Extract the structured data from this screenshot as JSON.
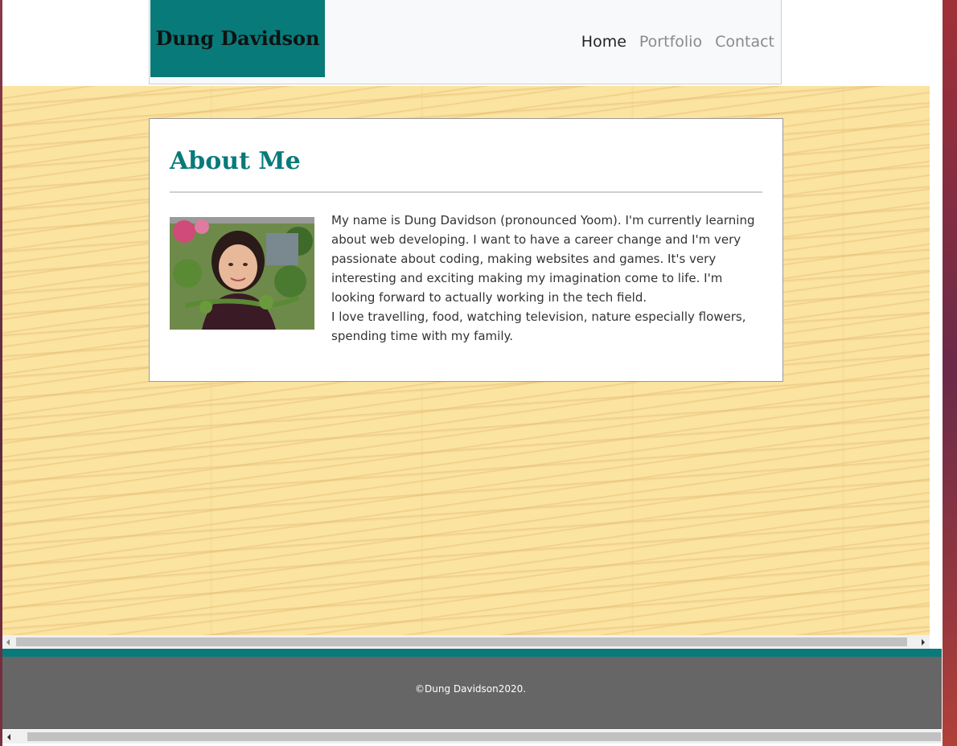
{
  "header": {
    "brand": "Dung Davidson",
    "nav": [
      {
        "label": "Home",
        "active": true
      },
      {
        "label": "Portfolio",
        "active": false
      },
      {
        "label": "Contact",
        "active": false
      }
    ]
  },
  "about": {
    "title": "About Me",
    "paragraphs": [
      "My name is Dung Davidson (pronounced Yoom). I'm currently learning about web developing. I want to have a career change and I'm very passionate about coding, making websites and games. It's very interesting and exciting making my imagination come to life. I'm looking forward to actually working in the tech field.",
      "I love travelling, food, watching television, nature especially flowers, spending time with my family."
    ]
  },
  "footer": {
    "copyright": "©Dung Davidson2020."
  },
  "colors": {
    "brand_teal": "#087a7a",
    "footer_gray": "#666666",
    "wood": "#fbe3a0"
  }
}
